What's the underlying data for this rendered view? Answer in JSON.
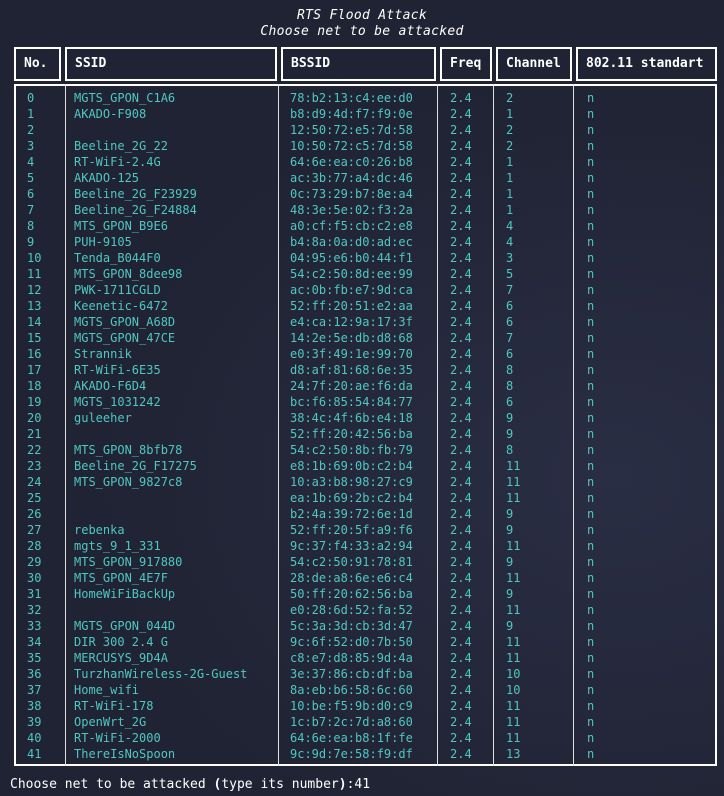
{
  "title": "RTS Flood Attack",
  "subtitle": "Choose net to be attacked",
  "columns": [
    "No.",
    "SSID",
    "BSSID",
    "Freq",
    "Channel",
    "802.11 standart"
  ],
  "rows": [
    [
      "0",
      "MGTS_GPON_C1A6",
      "78:b2:13:c4:ee:d0",
      "2.4",
      "2",
      "n"
    ],
    [
      "1",
      "AKADO-F908",
      "b8:d9:4d:f7:f9:0e",
      "2.4",
      "1",
      "n"
    ],
    [
      "2",
      "",
      "12:50:72:e5:7d:58",
      "2.4",
      "2",
      "n"
    ],
    [
      "3",
      "Beeline_2G_22",
      "10:50:72:c5:7d:58",
      "2.4",
      "2",
      "n"
    ],
    [
      "4",
      "RT-WiFi-2.4G",
      "64:6e:ea:c0:26:b8",
      "2.4",
      "1",
      "n"
    ],
    [
      "5",
      "AKADO-125",
      "ac:3b:77:a4:dc:46",
      "2.4",
      "1",
      "n"
    ],
    [
      "6",
      "Beeline_2G_F23929",
      "0c:73:29:b7:8e:a4",
      "2.4",
      "1",
      "n"
    ],
    [
      "7",
      "Beeline_2G_F24884",
      "48:3e:5e:02:f3:2a",
      "2.4",
      "1",
      "n"
    ],
    [
      "8",
      "MTS_GPON_B9E6",
      "a0:cf:f5:cb:c2:e8",
      "2.4",
      "4",
      "n"
    ],
    [
      "9",
      "PUH-9105",
      "b4:8a:0a:d0:ad:ec",
      "2.4",
      "4",
      "n"
    ],
    [
      "10",
      "Tenda_B044F0",
      "04:95:e6:b0:44:f1",
      "2.4",
      "3",
      "n"
    ],
    [
      "11",
      "MTS_GPON_8dee98",
      "54:c2:50:8d:ee:99",
      "2.4",
      "5",
      "n"
    ],
    [
      "12",
      "PWK-1711CGLD",
      "ac:0b:fb:e7:9d:ca",
      "2.4",
      "7",
      "n"
    ],
    [
      "13",
      "Keenetic-6472",
      "52:ff:20:51:e2:aa",
      "2.4",
      "6",
      "n"
    ],
    [
      "14",
      "MGTS_GPON_A68D",
      "e4:ca:12:9a:17:3f",
      "2.4",
      "6",
      "n"
    ],
    [
      "15",
      "MGTS_GPON_47CE",
      "14:2e:5e:db:d8:68",
      "2.4",
      "7",
      "n"
    ],
    [
      "16",
      "Strannik",
      "e0:3f:49:1e:99:70",
      "2.4",
      "6",
      "n"
    ],
    [
      "17",
      "RT-WiFi-6E35",
      "d8:af:81:68:6e:35",
      "2.4",
      "8",
      "n"
    ],
    [
      "18",
      "AKADO-F6D4",
      "24:7f:20:ae:f6:da",
      "2.4",
      "8",
      "n"
    ],
    [
      "19",
      "MGTS_1031242",
      "bc:f6:85:54:84:77",
      "2.4",
      "6",
      "n"
    ],
    [
      "20",
      "guleeher",
      "38:4c:4f:6b:e4:18",
      "2.4",
      "9",
      "n"
    ],
    [
      "21",
      "",
      "52:ff:20:42:56:ba",
      "2.4",
      "9",
      "n"
    ],
    [
      "22",
      "MTS_GPON_8bfb78",
      "54:c2:50:8b:fb:79",
      "2.4",
      "8",
      "n"
    ],
    [
      "23",
      "Beeline_2G_F17275",
      "e8:1b:69:0b:c2:b4",
      "2.4",
      "11",
      "n"
    ],
    [
      "24",
      "MTS_GPON_9827c8",
      "10:a3:b8:98:27:c9",
      "2.4",
      "11",
      "n"
    ],
    [
      "25",
      "",
      "ea:1b:69:2b:c2:b4",
      "2.4",
      "11",
      "n"
    ],
    [
      "26",
      "",
      "b2:4a:39:72:6e:1d",
      "2.4",
      "9",
      "n"
    ],
    [
      "27",
      "rebenka",
      "52:ff:20:5f:a9:f6",
      "2.4",
      "9",
      "n"
    ],
    [
      "28",
      "mgts_9_1_331",
      "9c:37:f4:33:a2:94",
      "2.4",
      "11",
      "n"
    ],
    [
      "29",
      "MTS_GPON_917880",
      "54:c2:50:91:78:81",
      "2.4",
      "9",
      "n"
    ],
    [
      "30",
      "MTS_GPON_4E7F",
      "28:de:a8:6e:e6:c4",
      "2.4",
      "11",
      "n"
    ],
    [
      "31",
      "HomeWiFiBackUp",
      "50:ff:20:62:56:ba",
      "2.4",
      "9",
      "n"
    ],
    [
      "32",
      "",
      "e0:28:6d:52:fa:52",
      "2.4",
      "11",
      "n"
    ],
    [
      "33",
      "MGTS_GPON_044D",
      "5c:3a:3d:cb:3d:47",
      "2.4",
      "9",
      "n"
    ],
    [
      "34",
      "DIR 300 2.4 G",
      "9c:6f:52:d0:7b:50",
      "2.4",
      "11",
      "n"
    ],
    [
      "35",
      "MERCUSYS_9D4A",
      "c8:e7:d8:85:9d:4a",
      "2.4",
      "11",
      "n"
    ],
    [
      "36",
      "TurzhanWireless-2G-Guest",
      "3e:37:86:cb:df:ba",
      "2.4",
      "10",
      "n"
    ],
    [
      "37",
      "Home_wifi",
      "8a:eb:b6:58:6c:60",
      "2.4",
      "10",
      "n"
    ],
    [
      "38",
      "RT-WiFi-178",
      "10:be:f5:9b:d0:c9",
      "2.4",
      "11",
      "n"
    ],
    [
      "39",
      "OpenWrt_2G",
      "1c:b7:2c:7d:a8:60",
      "2.4",
      "11",
      "n"
    ],
    [
      "40",
      "RT-WiFi-2000",
      "64:6e:ea:b8:1f:fe",
      "2.4",
      "11",
      "n"
    ],
    [
      "41",
      "ThereIsNoSpoon",
      "9c:9d:7e:58:f9:df",
      "2.4",
      "13",
      "n"
    ]
  ],
  "prompt": {
    "text_a": "Choose net to be attacked ",
    "text_b": "(",
    "text_c": "type its number",
    "text_d": ")",
    "text_e": ":41"
  },
  "colors": {
    "row_text": "#4fc7c2",
    "border": "#ffffff",
    "background": "#202333"
  }
}
